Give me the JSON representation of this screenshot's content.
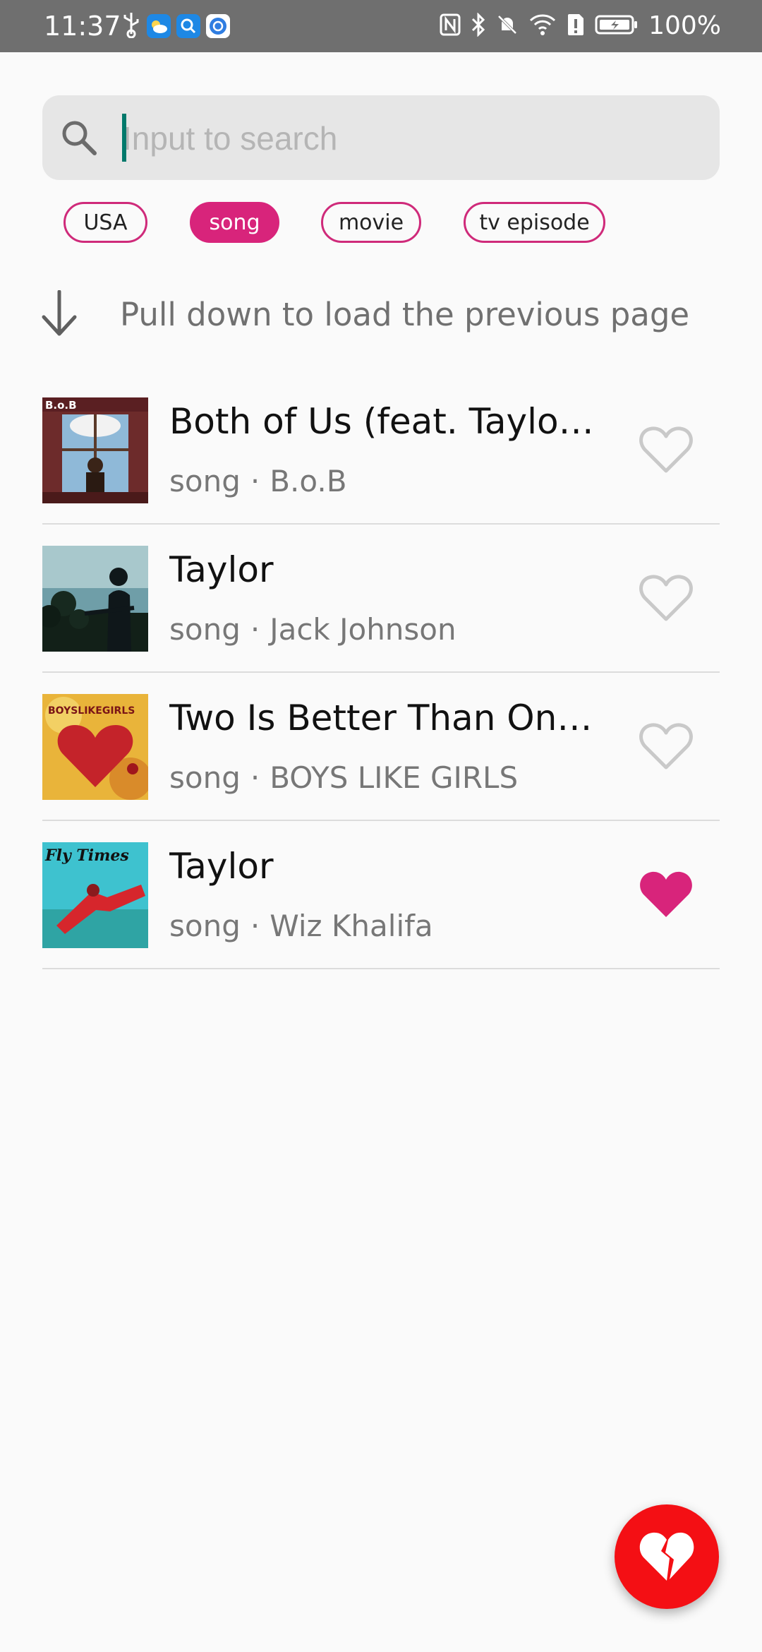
{
  "status_bar": {
    "time": "11:37",
    "battery_text": "100%",
    "left_icons": [
      "usb-icon",
      "weather-app-icon",
      "search-app-icon",
      "browser-app-icon"
    ],
    "right_icons": [
      "nfc-icon",
      "bluetooth-icon",
      "mute-bell-icon",
      "wifi-icon",
      "sim-alert-icon",
      "battery-charging-icon"
    ]
  },
  "search": {
    "placeholder": "Input to search",
    "value": ""
  },
  "chips": [
    {
      "label": "USA",
      "selected": false
    },
    {
      "label": "song",
      "selected": true
    },
    {
      "label": "movie",
      "selected": false
    },
    {
      "label": "tv episode",
      "selected": false
    }
  ],
  "pull_hint": {
    "text": "Pull down to load the previous page",
    "icon": "arrow-down-icon"
  },
  "results": [
    {
      "title": "Both of Us (feat. Taylor Sw…",
      "kind": "song",
      "separator": "·",
      "artist": "B.o.B",
      "favorite": false
    },
    {
      "title": "Taylor",
      "kind": "song",
      "separator": "·",
      "artist": "Jack Johnson",
      "favorite": false
    },
    {
      "title": "Two Is Better Than One (fe…",
      "kind": "song",
      "separator": "·",
      "artist": "BOYS LIKE GIRLS",
      "favorite": false
    },
    {
      "title": "Taylor",
      "kind": "song",
      "separator": "·",
      "artist": "Wiz Khalifa",
      "favorite": true
    }
  ],
  "artwork_text": {
    "cover_1": "B.o.B",
    "cover_3": "BOYSLIKEGIRLS",
    "cover_4": "Fly Times"
  },
  "colors": {
    "accent": "#d8247b",
    "fab": "#f40f14",
    "status_bar": "#6f6f6f",
    "search_bg": "#e6e6e6",
    "caret": "#00796b"
  },
  "fab": {
    "icon": "broken-heart-icon"
  }
}
